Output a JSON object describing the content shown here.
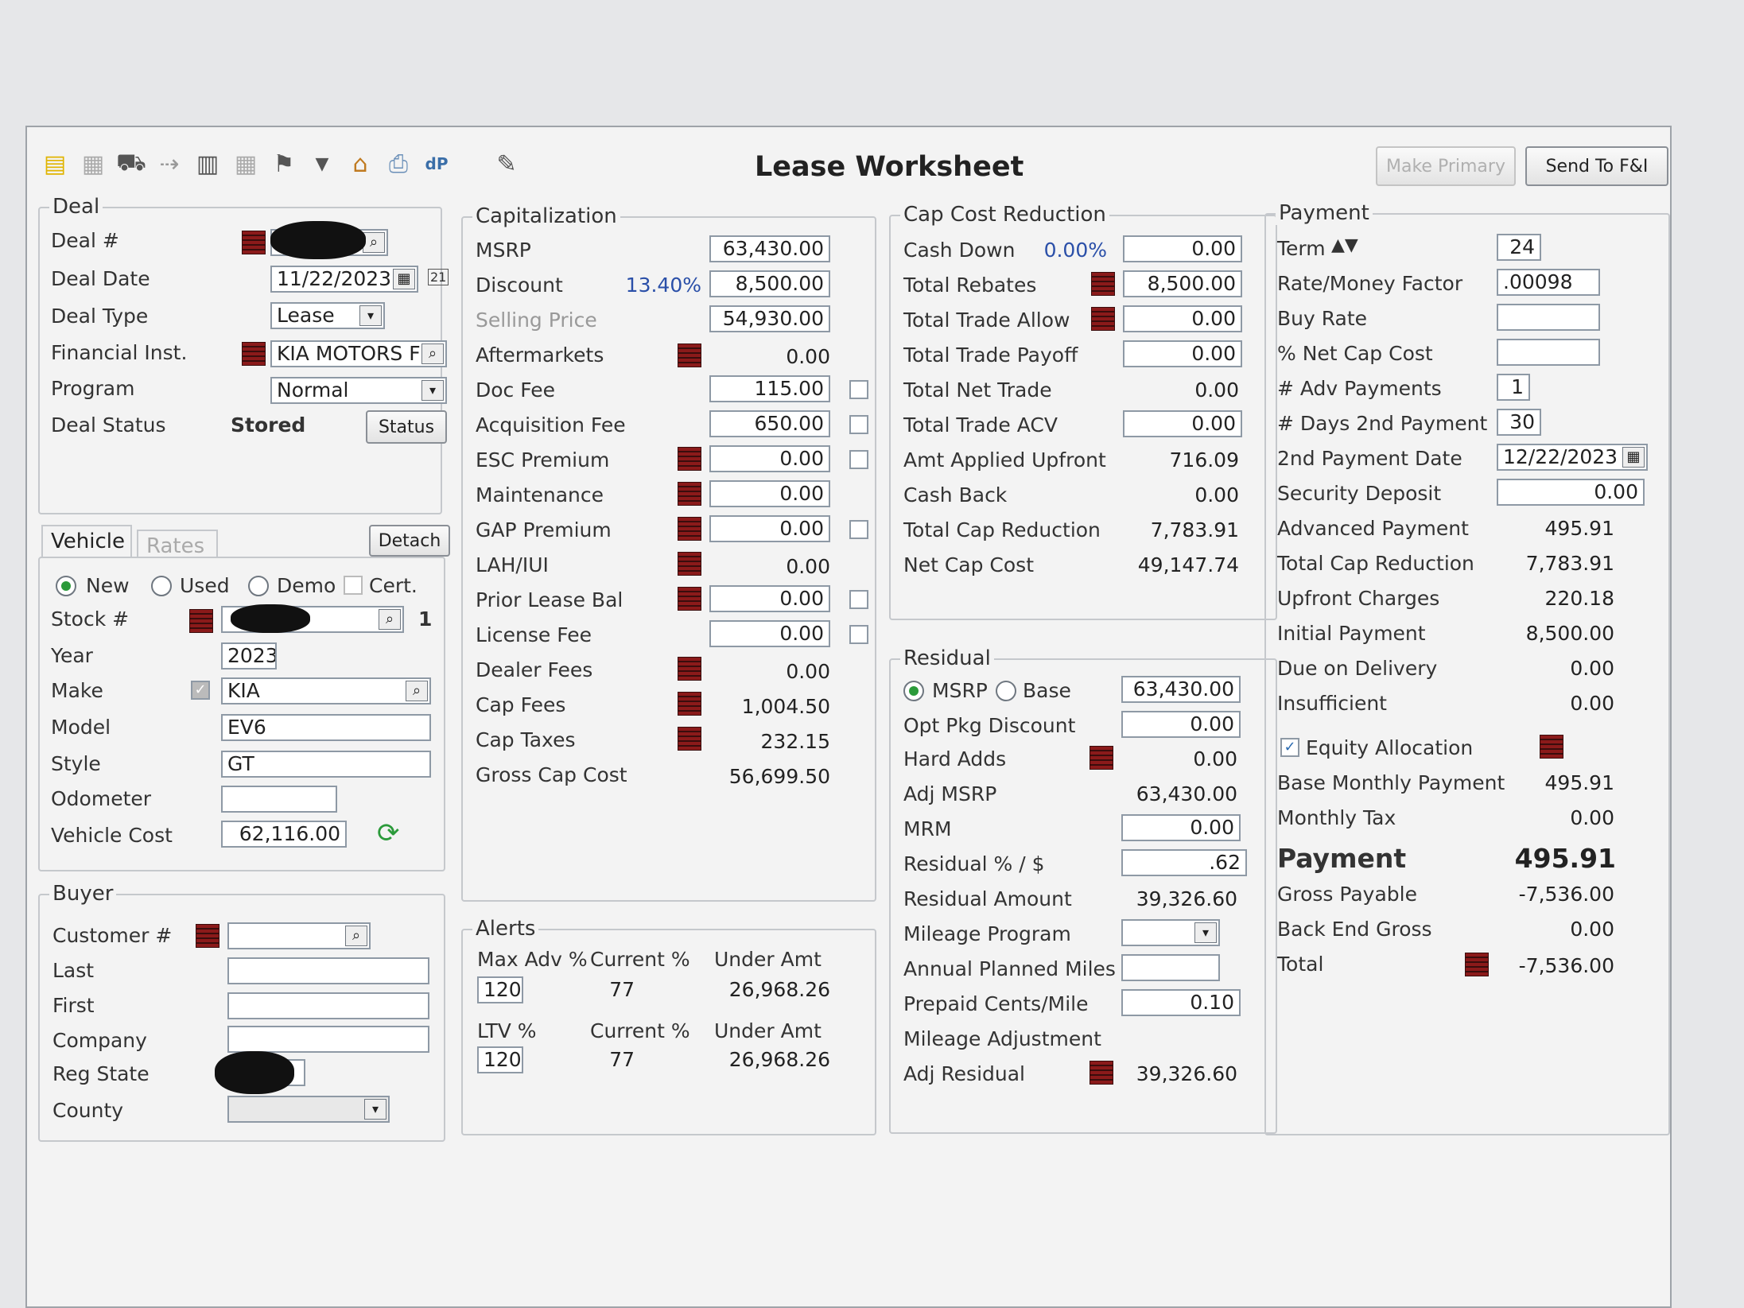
{
  "window": {
    "title": "Lease Worksheet",
    "make_primary": "Make Primary",
    "send_to_fi": "Send To F&I"
  },
  "toolbar": {
    "icons": [
      "folder-icon",
      "notes-icon",
      "car-icon",
      "signpost-icon",
      "clipboard-icon",
      "calendar-grid-icon",
      "flag-icon",
      "dropdown-arrow-icon",
      "dollar-house-icon",
      "printer-icon",
      "dp-icon",
      "edit-icon"
    ]
  },
  "deal": {
    "legend": "Deal",
    "deal_no_label": "Deal #",
    "deal_date_label": "Deal Date",
    "deal_date": "11/22/2023",
    "deal_type_label": "Deal Type",
    "deal_type": "Lease",
    "fin_inst_label": "Financial Inst.",
    "fin_inst": "KIA MOTORS F",
    "program_label": "Program",
    "program": "Normal",
    "status_label": "Deal Status",
    "status": "Stored",
    "status_button": "Status"
  },
  "vehicle": {
    "tab_vehicle": "Vehicle",
    "tab_rates": "Rates",
    "detach": "Detach",
    "new": "New",
    "used": "Used",
    "demo": "Demo",
    "cert": "Cert.",
    "stock_label": "Stock #",
    "stock_count": "1",
    "year_label": "Year",
    "year": "2023",
    "make_label": "Make",
    "make": "KIA",
    "model_label": "Model",
    "model": "EV6",
    "style_label": "Style",
    "style": "GT",
    "odometer_label": "Odometer",
    "odometer": "",
    "cost_label": "Vehicle Cost",
    "cost": "62,116.00"
  },
  "buyer": {
    "legend": "Buyer",
    "customer_label": "Customer #",
    "last_label": "Last",
    "first_label": "First",
    "company_label": "Company",
    "reg_state_label": "Reg State",
    "county_label": "County"
  },
  "cap": {
    "legend": "Capitalization",
    "msrp_label": "MSRP",
    "msrp": "63,430.00",
    "discount_label": "Discount",
    "discount_pct": "13.40%",
    "discount": "8,500.00",
    "selling_label": "Selling Price",
    "selling": "54,930.00",
    "after_label": "Aftermarkets",
    "after": "0.00",
    "doc_label": "Doc Fee",
    "doc": "115.00",
    "acq_label": "Acquisition Fee",
    "acq": "650.00",
    "esc_label": "ESC Premium",
    "esc": "0.00",
    "maint_label": "Maintenance",
    "maint": "0.00",
    "gap_label": "GAP Premium",
    "gap": "0.00",
    "lah_label": "LAH/IUI",
    "lah": "0.00",
    "prior_label": "Prior Lease Bal",
    "prior": "0.00",
    "license_label": "License Fee",
    "license": "0.00",
    "dealer_label": "Dealer Fees",
    "dealer": "0.00",
    "capfees_label": "Cap Fees",
    "capfees": "1,004.50",
    "captax_label": "Cap Taxes",
    "captax": "232.15",
    "gross_label": "Gross Cap Cost",
    "gross": "56,699.50"
  },
  "alerts": {
    "legend": "Alerts",
    "max_adv_label": "Max Adv %",
    "current_label": "Current %",
    "under_label": "Under Amt",
    "max_adv": "120",
    "current1": "77",
    "under1": "26,968.26",
    "ltv_label": "LTV %",
    "current_label2": "Current %",
    "under_label2": "Under Amt",
    "ltv": "120",
    "current2": "77",
    "under2": "26,968.26"
  },
  "ccr": {
    "legend": "Cap Cost Reduction",
    "cash_down_label": "Cash Down",
    "cash_down_pct": "0.00%",
    "cash_down": "0.00",
    "rebates_label": "Total Rebates",
    "rebates": "8,500.00",
    "trade_allow_label": "Total Trade Allow",
    "trade_allow": "0.00",
    "trade_payoff_label": "Total Trade Payoff",
    "trade_payoff": "0.00",
    "net_trade_label": "Total Net Trade",
    "net_trade": "0.00",
    "trade_acv_label": "Total Trade ACV",
    "trade_acv": "0.00",
    "amt_applied_label": "Amt Applied Upfront",
    "amt_applied": "716.09",
    "cash_back_label": "Cash Back",
    "cash_back": "0.00",
    "total_ccr_label": "Total Cap Reduction",
    "total_ccr": "7,783.91",
    "net_cap_label": "Net Cap Cost",
    "net_cap": "49,147.74"
  },
  "residual": {
    "legend": "Residual",
    "msrp": "MSRP",
    "base": "Base",
    "base_value": "63,430.00",
    "opt_label": "Opt Pkg Discount",
    "opt": "0.00",
    "hard_label": "Hard Adds",
    "hard": "0.00",
    "adj_msrp_label": "Adj MSRP",
    "adj_msrp": "63,430.00",
    "mrm_label": "MRM",
    "mrm": "0.00",
    "res_pct_label": "Residual % / $",
    "res_pct": ".62",
    "res_amt_label": "Residual Amount",
    "res_amt": "39,326.60",
    "mileage_prog_label": "Mileage Program",
    "annual_label": "Annual Planned Miles",
    "annual": "",
    "prepaid_label": "Prepaid Cents/Mile",
    "prepaid": "0.10",
    "mileage_adj_label": "Mileage Adjustment",
    "adj_res_label": "Adj Residual",
    "adj_res": "39,326.60"
  },
  "payment": {
    "legend": "Payment",
    "term_label": "Term",
    "term": "24",
    "rate_label": "Rate/Money Factor",
    "rate": ".00098",
    "buy_rate_label": "Buy Rate",
    "buy_rate": "",
    "net_cap_pct_label": "% Net Cap Cost",
    "net_cap_pct": "",
    "adv_label": "# Adv Payments",
    "adv": "1",
    "days_label": "# Days 2nd Payment",
    "days": "30",
    "date2_label": "2nd Payment Date",
    "date2": "12/22/2023",
    "sec_label": "Security Deposit",
    "sec": "0.00",
    "adv_pay_label": "Advanced Payment",
    "adv_pay": "495.91",
    "tcr_label": "Total Cap Reduction",
    "tcr": "7,783.91",
    "upfront_label": "Upfront Charges",
    "upfront": "220.18",
    "initial_label": "Initial Payment",
    "initial": "8,500.00",
    "due_label": "Due on Delivery",
    "due": "0.00",
    "insuff_label": "Insufficient",
    "insuff": "0.00",
    "equity_label": "Equity Allocation",
    "base_label": "Base Monthly Payment",
    "base": "495.91",
    "tax_label": "Monthly Tax",
    "tax": "0.00",
    "payment_label": "Payment",
    "payment": "495.91",
    "gross_pay_label": "Gross Payable",
    "gross_pay": "-7,536.00",
    "beg_label": "Back End Gross",
    "beg": "0.00",
    "total_label": "Total",
    "total": "-7,536.00"
  }
}
